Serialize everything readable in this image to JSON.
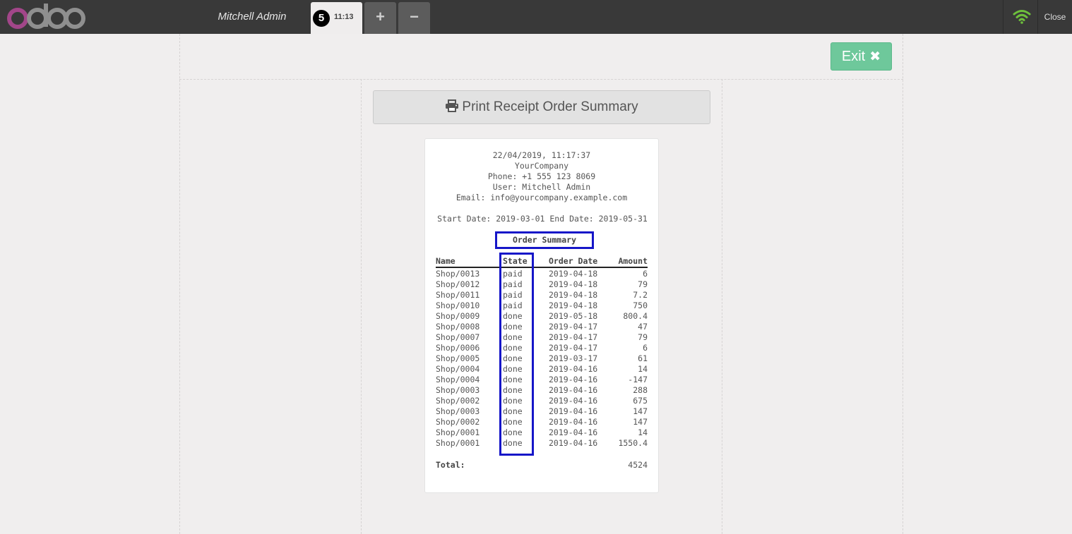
{
  "topbar": {
    "logo_text": "odoo",
    "cashier_name": "Mitchell Admin",
    "order_tab": {
      "sequence": "5",
      "time": "11:13"
    },
    "add_order_label": "+",
    "remove_order_label": "−",
    "close_label": "Close",
    "wifi_color": "#6ec03c"
  },
  "actions": {
    "exit_label": "Exit",
    "exit_icon": "✖",
    "print_label": "Print Receipt Order Summary",
    "print_icon": "printer-icon"
  },
  "receipt": {
    "datetime": "22/04/2019, 11:17:37",
    "company": "YourCompany",
    "phone": "Phone: +1 555 123 8069",
    "user": "User: Mitchell Admin",
    "email": "Email: info@yourcompany.example.com",
    "date_range": "Start Date: 2019-03-01 End Date: 2019-05-31",
    "summary_title": "Order Summary",
    "columns": {
      "name": "Name",
      "state": "State",
      "order_date": "Order Date",
      "amount": "Amount"
    },
    "rows": [
      {
        "name": "Shop/0013",
        "state": "paid",
        "date": "2019-04-18",
        "amount": "6"
      },
      {
        "name": "Shop/0012",
        "state": "paid",
        "date": "2019-04-18",
        "amount": "79"
      },
      {
        "name": "Shop/0011",
        "state": "paid",
        "date": "2019-04-18",
        "amount": "7.2"
      },
      {
        "name": "Shop/0010",
        "state": "paid",
        "date": "2019-04-18",
        "amount": "750"
      },
      {
        "name": "Shop/0009",
        "state": "done",
        "date": "2019-05-18",
        "amount": "800.4"
      },
      {
        "name": "Shop/0008",
        "state": "done",
        "date": "2019-04-17",
        "amount": "47"
      },
      {
        "name": "Shop/0007",
        "state": "done",
        "date": "2019-04-17",
        "amount": "79"
      },
      {
        "name": "Shop/0006",
        "state": "done",
        "date": "2019-04-17",
        "amount": "6"
      },
      {
        "name": "Shop/0005",
        "state": "done",
        "date": "2019-03-17",
        "amount": "61"
      },
      {
        "name": "Shop/0004",
        "state": "done",
        "date": "2019-04-16",
        "amount": "14"
      },
      {
        "name": "Shop/0004",
        "state": "done",
        "date": "2019-04-16",
        "amount": "-147"
      },
      {
        "name": "Shop/0003",
        "state": "done",
        "date": "2019-04-16",
        "amount": "288"
      },
      {
        "name": "Shop/0002",
        "state": "done",
        "date": "2019-04-16",
        "amount": "675"
      },
      {
        "name": "Shop/0003",
        "state": "done",
        "date": "2019-04-16",
        "amount": "147"
      },
      {
        "name": "Shop/0002",
        "state": "done",
        "date": "2019-04-16",
        "amount": "147"
      },
      {
        "name": "Shop/0001",
        "state": "done",
        "date": "2019-04-16",
        "amount": "14"
      },
      {
        "name": "Shop/0001",
        "state": "done",
        "date": "2019-04-16",
        "amount": "1550.4"
      }
    ],
    "total_label": "Total:",
    "total_value": "4524"
  },
  "colors": {
    "topbar": "#393939",
    "highlight": "#1616c8",
    "exit_button": "#6ec89b"
  }
}
